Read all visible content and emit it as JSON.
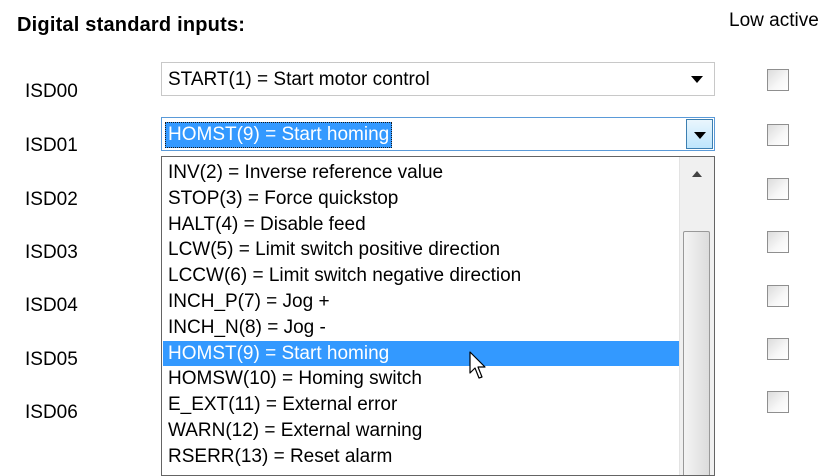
{
  "section": {
    "title": "Digital standard inputs:",
    "low_active_header": "Low active"
  },
  "rows": [
    {
      "label": "ISD00",
      "value": "START(1) = Start motor control",
      "low_active": false
    },
    {
      "label": "ISD01",
      "value": "HOMST(9) = Start homing",
      "low_active": false
    },
    {
      "label": "ISD02",
      "low_active": false
    },
    {
      "label": "ISD03",
      "low_active": false
    },
    {
      "label": "ISD04",
      "low_active": false
    },
    {
      "label": "ISD05",
      "low_active": false
    },
    {
      "label": "ISD06",
      "low_active": false
    }
  ],
  "dropdown": {
    "options": [
      "INV(2) = Inverse reference value",
      "STOP(3) = Force quickstop",
      "HALT(4) = Disable feed",
      "LCW(5) = Limit switch positive direction",
      "LCCW(6) = Limit switch negative direction",
      "INCH_P(7) = Jog +",
      "INCH_N(8) = Jog -",
      "HOMST(9) = Start homing",
      "HOMSW(10) = Homing switch",
      "E_EXT(11) = External error",
      "WARN(12) = External warning",
      "RSERR(13) = Reset alarm"
    ],
    "selected": "HOMST(9) = Start homing"
  },
  "colors": {
    "selection": "#3399ff",
    "focus_border": "#5a9ad8"
  },
  "icons": [
    "dropdown-arrow-icon",
    "scroll-up-arrow-icon",
    "mouse-pointer-icon"
  ]
}
